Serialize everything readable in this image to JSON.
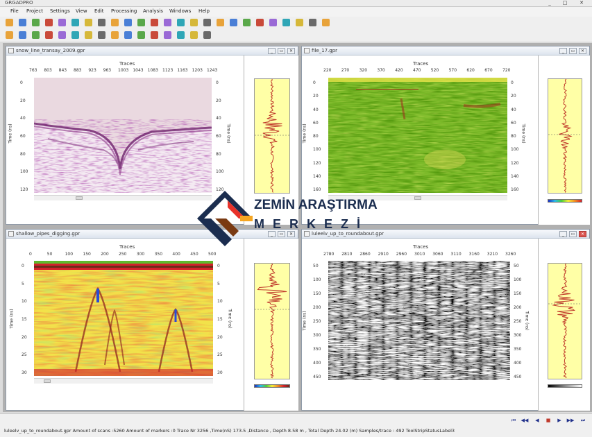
{
  "app": {
    "title": "GRGADPRO"
  },
  "window_controls": {
    "minimize": "_",
    "maximize": "□",
    "close": "✕"
  },
  "menu": [
    "File",
    "Project",
    "Settings",
    "View",
    "Edit",
    "Processing",
    "Analysis",
    "Windows",
    "Help"
  ],
  "toolbar1": {
    "icons": [
      "open-icon",
      "save-icon",
      "print-icon",
      "folder-icon",
      "scissors-icon",
      "chart-icon",
      "notes-icon",
      "grid-icon",
      "grid-icon",
      "table-icon",
      "arrow-icon",
      "arrow-icon",
      "undo-icon",
      "ruler-icon",
      "eraser-icon",
      "cut-icon",
      "map-icon",
      "hand-icon",
      "filter-icon",
      "target-icon",
      "flag-icon",
      "marker-icon",
      "tree-icon",
      "shape-icon",
      "help-icon"
    ]
  },
  "toolbar2": {
    "icons": [
      "filter-icon",
      "layers-icon",
      "tool-icon",
      "cross-icon",
      "pin-icon",
      "radar-icon",
      "grid-icon",
      "marker-icon",
      "pin-icon",
      "dig-icon",
      "layer-icon",
      "color-icon",
      "spectrum-icon",
      "cut-icon",
      "screen-icon",
      "export-icon"
    ]
  },
  "windows": [
    {
      "title": "snow_line_transay_2009.gpr",
      "traces_label": "Traces",
      "x_ticks": [
        "763",
        "803",
        "843",
        "883",
        "923",
        "963",
        "1003",
        "1043",
        "1083",
        "1123",
        "1163",
        "1203",
        "1243"
      ],
      "y_ticks": [
        "0",
        "20",
        "40",
        "60",
        "80",
        "100",
        "120"
      ],
      "y_label": "Time (ns)",
      "y_label_right": "Time (ns)",
      "colorbar": "none"
    },
    {
      "title": "file_17.gpr",
      "traces_label": "Traces",
      "x_ticks": [
        "220",
        "270",
        "320",
        "370",
        "420",
        "470",
        "520",
        "570",
        "620",
        "670",
        "720"
      ],
      "y_ticks": [
        "0",
        "20",
        "40",
        "60",
        "80",
        "100",
        "120",
        "140",
        "160"
      ],
      "y_label": "Time (ns)",
      "y_label_right": "Time (ns)",
      "colorbar": "rainbow"
    },
    {
      "title": "shallow_pipes_digging.gpr",
      "traces_label": "Traces",
      "x_ticks": [
        "0",
        "50",
        "100",
        "150",
        "200",
        "250",
        "300",
        "350",
        "400",
        "450",
        "500"
      ],
      "y_ticks": [
        "0",
        "5",
        "10",
        "15",
        "20",
        "25",
        "30"
      ],
      "y_label": "Time (ns)",
      "y_label_right": "Time (ns)",
      "colorbar": "rainbow"
    },
    {
      "title": "luleelv_up_to_roundabout.gpr",
      "traces_label": "Traces",
      "x_ticks": [
        "2780",
        "2810",
        "2860",
        "2910",
        "2960",
        "3010",
        "3060",
        "3110",
        "3160",
        "3210",
        "3260"
      ],
      "y_ticks": [
        "50",
        "100",
        "150",
        "200",
        "250",
        "300",
        "350",
        "400",
        "450"
      ],
      "y_label": "Time (ns)",
      "y_label_right": "Time (ns)",
      "colorbar": "gray"
    }
  ],
  "watermark": {
    "line1": "ZEMİN ARAŞTIRMA",
    "line2": "MERKEZİ"
  },
  "status": {
    "text": "luleelv_up_to_roundabout.gpr Amount of scans :5260  Amount of markers :0  Trace Nr 3256  ,Time(nS) 173.5 ,Distance , Depth 8.58 m  , Total Depth 24.02  (m)  Samples/trace : 492  ToolStripStatusLabel3"
  },
  "nav_buttons": [
    "first",
    "prev-fast",
    "prev",
    "stop",
    "next",
    "next-fast",
    "last"
  ],
  "colors": {
    "accent": "#1f2f8a",
    "logo_navy": "#1b2d4f",
    "logo_red": "#e8322a",
    "logo_orange": "#f5a623"
  }
}
